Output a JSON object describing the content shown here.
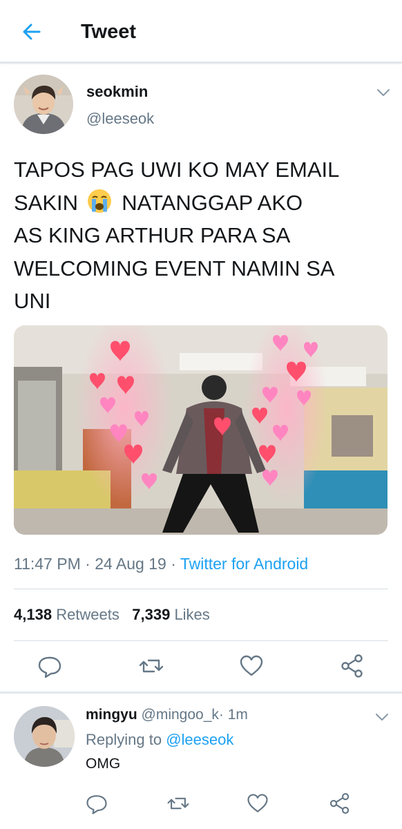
{
  "header": {
    "title": "Tweet"
  },
  "tweet": {
    "author_name": "seokmin",
    "author_handle": "@leeseok",
    "text_lines": [
      "TAPOS PAG UWI KO MAY EMAIL",
      "SAKIN",
      "NATANGGAP AKO",
      "AS KING ARTHUR PARA SA",
      "WELCOMING EVENT NAMIN SA",
      "UNI"
    ],
    "emoji": "loudly-crying-face",
    "time": "11:47 PM",
    "date": "24 Aug 19",
    "separator": "·",
    "source": "Twitter for Android",
    "retweets_count": "4,138",
    "retweets_label": "Retweets",
    "likes_count": "7,339",
    "likes_label": "Likes"
  },
  "reply": {
    "author_name": "mingyu",
    "author_handle": "@mingoo_k",
    "separator": "·",
    "age": "1m",
    "replying_prefix": "Replying to",
    "replying_to": "@leeseok",
    "text": "OMG"
  },
  "colors": {
    "accent": "#1da1f2",
    "secondary_text": "#657786",
    "divider": "#e1e8ed"
  },
  "icons": [
    "back-arrow-icon",
    "chevron-down-icon",
    "reply-icon",
    "retweet-icon",
    "like-icon",
    "share-icon"
  ]
}
